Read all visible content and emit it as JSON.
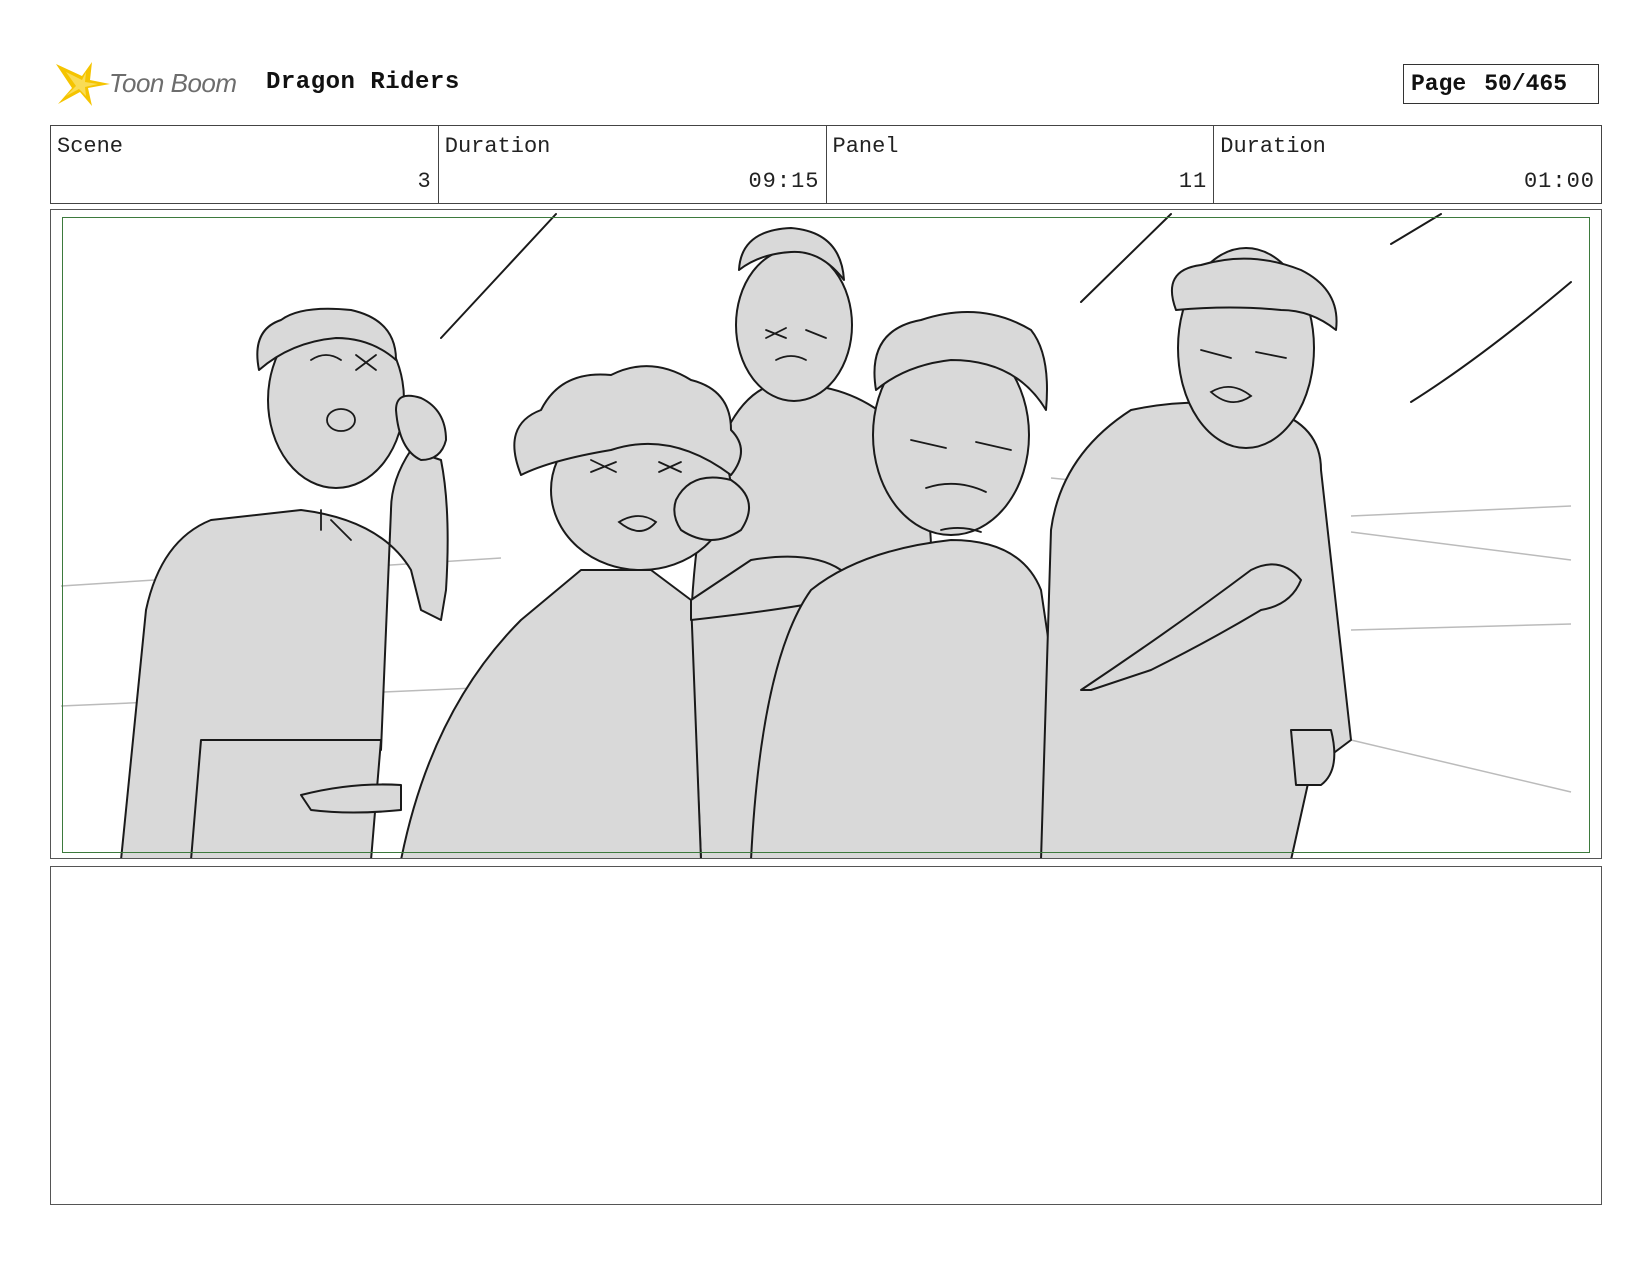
{
  "header": {
    "logo_text": "Toon Boom",
    "project_title": "Dragon Riders",
    "page_label": "Page",
    "page_number": "50/465"
  },
  "info": {
    "scene_label": "Scene",
    "scene_value": "3",
    "scene_duration_label": "Duration",
    "scene_duration_value": "09:15",
    "panel_label": "Panel",
    "panel_value": "11",
    "panel_duration_label": "Duration",
    "panel_duration_value": "01:00"
  },
  "colors": {
    "logo_yellow": "#f5c400",
    "safe_frame_green": "#3d7a3d",
    "sketch_fill": "#d9d9d9",
    "sketch_line": "#1a1a1a"
  },
  "notes": {
    "text": ""
  }
}
